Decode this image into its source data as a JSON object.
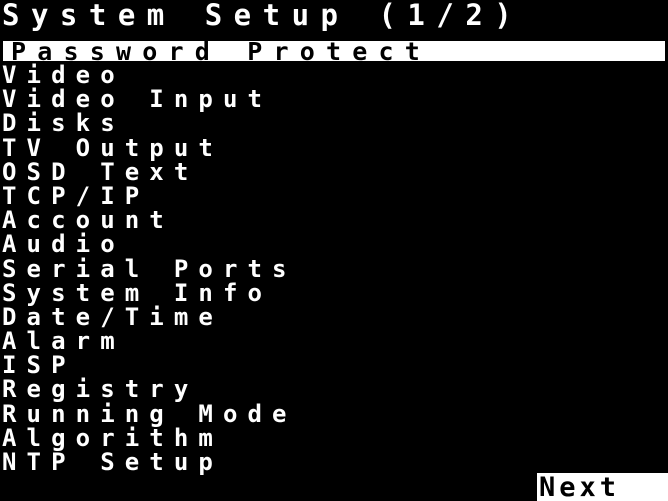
{
  "screen": {
    "title": "System Setup (1/2)",
    "selected_index": 0,
    "menu": [
      {
        "label": "Password Protect"
      },
      {
        "label": "Video"
      },
      {
        "label": "Video Input"
      },
      {
        "label": "Disks"
      },
      {
        "label": "TV Output"
      },
      {
        "label": "OSD Text"
      },
      {
        "label": "TCP/IP"
      },
      {
        "label": "Account"
      },
      {
        "label": "Audio"
      },
      {
        "label": "Serial Ports"
      },
      {
        "label": "System Info"
      },
      {
        "label": "Date/Time"
      },
      {
        "label": "Alarm"
      },
      {
        "label": "ISP"
      },
      {
        "label": "Registry"
      },
      {
        "label": "Running Mode"
      },
      {
        "label": "Algorithm"
      },
      {
        "label": "NTP Setup"
      }
    ],
    "next_label": "Next"
  },
  "colors": {
    "background": "#000000",
    "text": "#ffffff",
    "highlight_bg": "#ffffff",
    "highlight_text": "#000000"
  }
}
